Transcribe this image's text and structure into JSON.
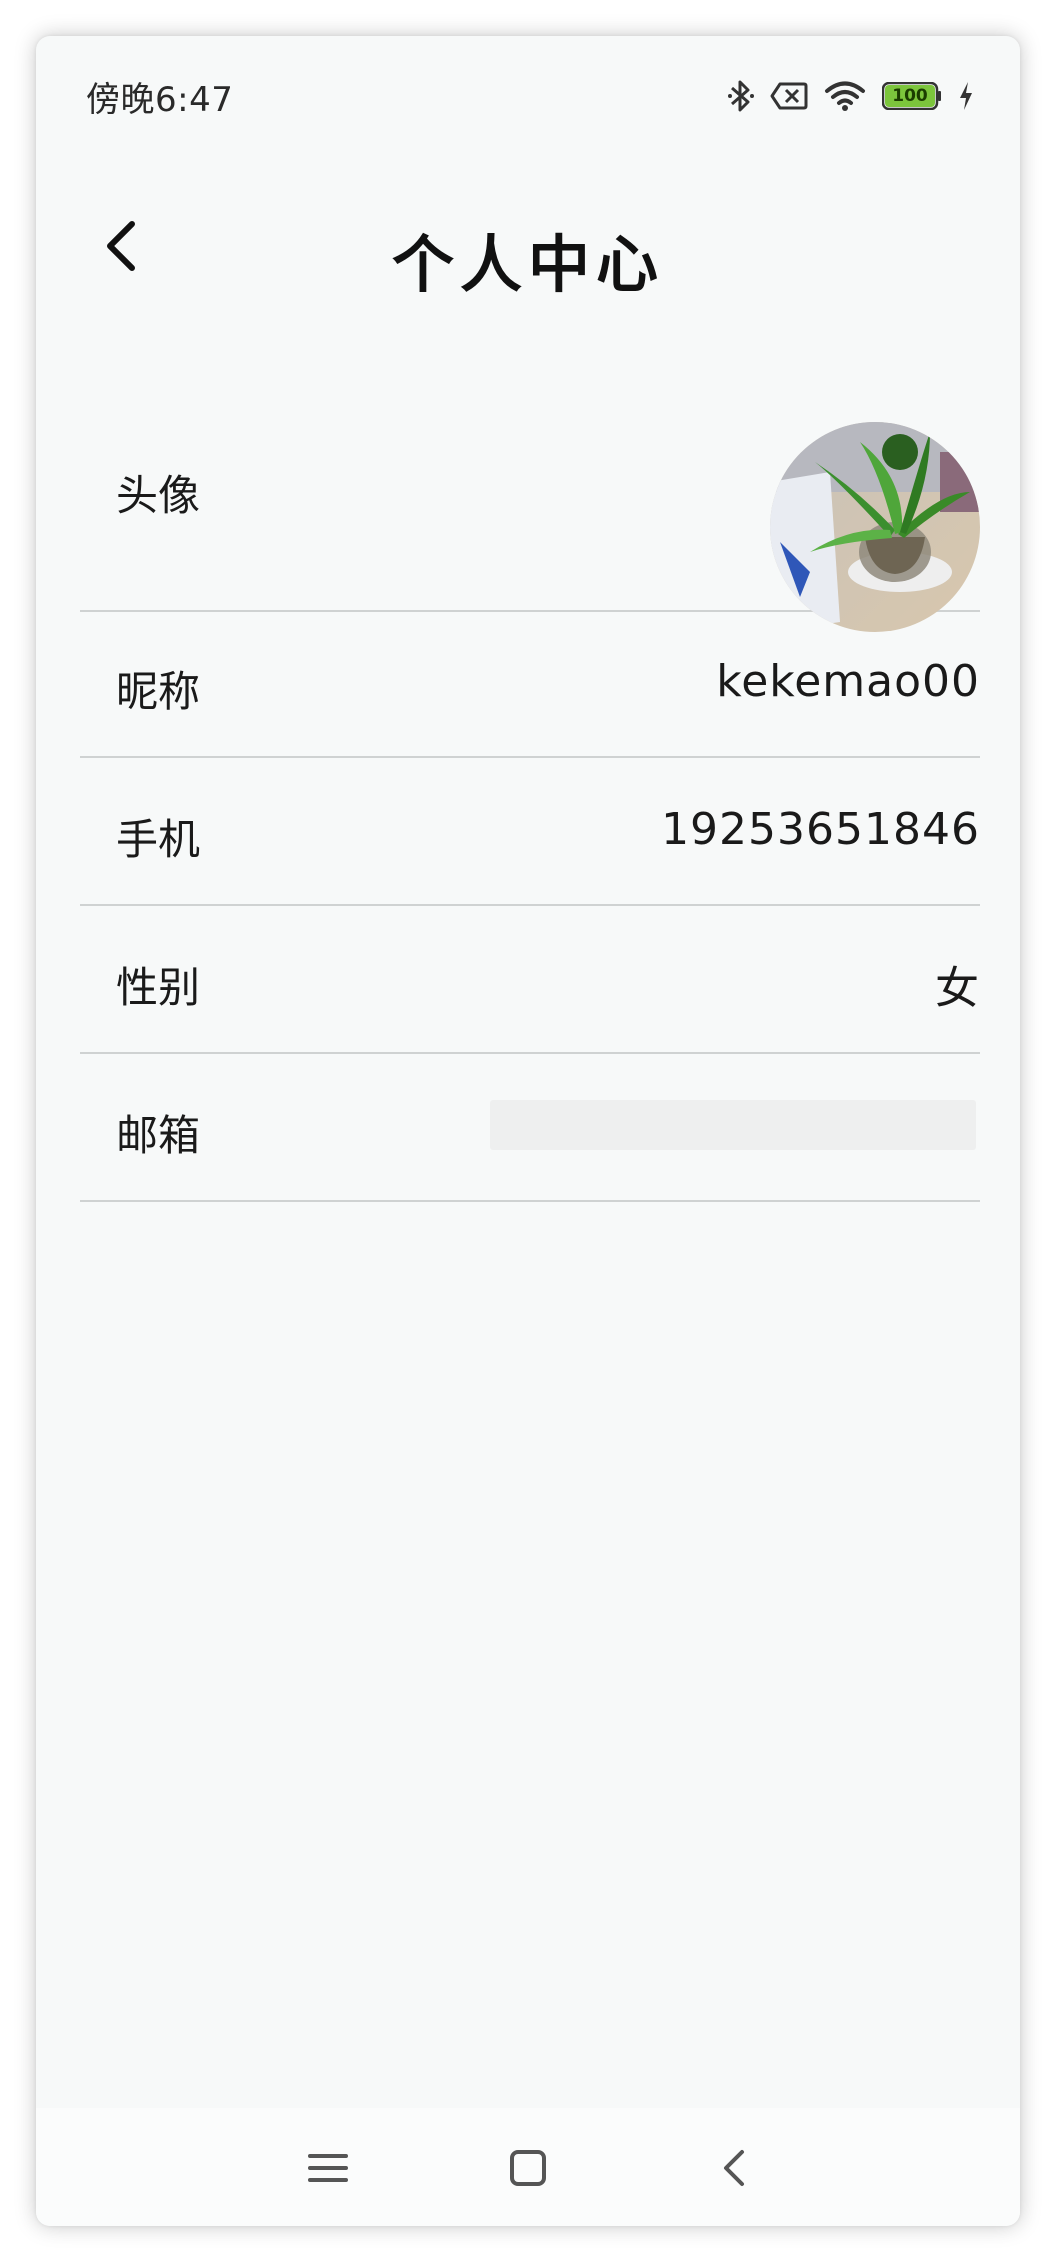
{
  "status_bar": {
    "time": "傍晚6:47",
    "battery_level": "100",
    "icons": [
      "bluetooth-icon",
      "sim-error-icon",
      "wifi-icon",
      "battery-icon",
      "charging-icon"
    ]
  },
  "header": {
    "title": "个人中心",
    "back_icon": "chevron-left-icon"
  },
  "profile": {
    "avatar_label": "头像",
    "nickname_label": "昵称",
    "nickname_value": "kekemao00",
    "phone_label": "手机",
    "phone_value": "19253651846",
    "gender_label": "性别",
    "gender_value": "女",
    "email_label": "邮箱",
    "email_value_visible": "n"
  },
  "nav_bar": {
    "icons": [
      "menu-icon",
      "home-icon",
      "back-icon"
    ]
  },
  "colors": {
    "background": "#f7f9f9",
    "divider": "#cfd2d2",
    "battery": "#7cc53c",
    "text": "#1a1a1a"
  }
}
